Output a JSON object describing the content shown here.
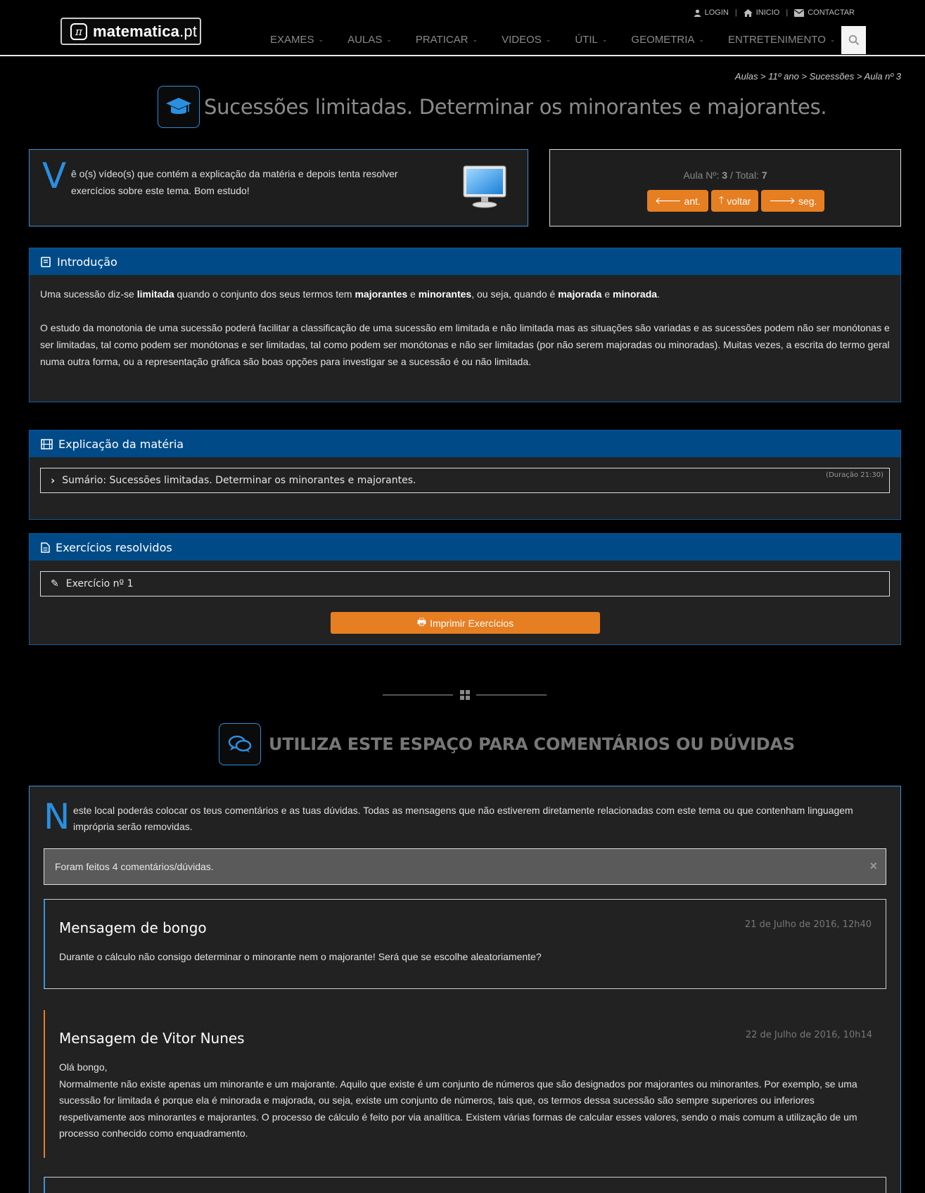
{
  "header": {
    "logo": {
      "prefix": "matematica",
      "suffix": ".pt"
    },
    "util_links": [
      {
        "label": "LOGIN",
        "icon": "user-icon"
      },
      {
        "label": "INICIO",
        "icon": "home-icon"
      },
      {
        "label": "CONTACTAR",
        "icon": "envelope-icon"
      }
    ],
    "nav": [
      "EXAMES",
      "AULAS",
      "PRATICAR",
      "VIDEOS",
      "ÚTIL",
      "GEOMETRIA",
      "ENTRETENIMENTO"
    ],
    "search_icon": "search-icon"
  },
  "breadcrumb": "Aulas > 11º ano > Sucessões > Aula nº 3",
  "page_title": "Sucessões limitadas. Determinar os minorantes e majorantes.",
  "info_box": {
    "dropcap": "V",
    "text": "ê o(s) vídeo(s) que contém a explicação da matéria e depois tenta resolver exercícios sobre este tema. Bom estudo!"
  },
  "lesson_nav": {
    "label": "Aula Nº:",
    "current": "3",
    "total_label": "/ Total:",
    "total": "7",
    "prev": "ant.",
    "back": "voltar",
    "next": "seg."
  },
  "intro_panel": {
    "title": "Introdução",
    "p1": [
      {
        "t": "Uma sucessão diz-se ",
        "b": false
      },
      {
        "t": "limitada",
        "b": true
      },
      {
        "t": " quando o conjunto dos seus termos tem ",
        "b": false
      },
      {
        "t": "majorantes",
        "b": true
      },
      {
        "t": " e ",
        "b": false
      },
      {
        "t": "minorantes",
        "b": true
      },
      {
        "t": ", ou seja, quando é ",
        "b": false
      },
      {
        "t": "majorada",
        "b": true
      },
      {
        "t": " e ",
        "b": false
      },
      {
        "t": "minorada",
        "b": true
      },
      {
        "t": ".",
        "b": false
      }
    ],
    "p2": "O estudo da monotonia de uma sucessão poderá facilitar a classificação de uma sucessão em limitada e não limitada mas as situações são variadas e as sucessões podem não ser monótonas e ser limitadas, tal como podem ser monótonas e ser limitadas, tal como podem ser monótonas e não ser limitadas (por não serem majoradas ou minoradas). Muitas vezes, a escrita do termo geral numa outra forma, ou a representação gráfica são boas opções para investigar se a sucessão é ou não limitada."
  },
  "explanation_panel": {
    "title": "Explicação da matéria",
    "item": "Sumário: Sucessões limitadas. Determinar os minorantes e majorantes.",
    "duration": "(Duração 21:30)"
  },
  "exercises_panel": {
    "title": "Exercícios resolvidos",
    "item": "Exercício nº 1",
    "print_button": "Imprimir Exercícios"
  },
  "comments": {
    "title": "UTILIZA ESTE ESPAÇO PARA COMENTÁRIOS OU DÚVIDAS",
    "dropcap": "N",
    "intro": "este local poderás colocar os teus comentários e as tuas dúvidas. Todas as mensagens que não estiverem diretamente relacionadas com este tema ou que contenham linguagem imprópria serão removidas.",
    "count_alert": "Foram feitos 4 comentários/dúvidas.",
    "close_symbol": "×",
    "messages": [
      {
        "title": "Mensagem de bongo",
        "date": "21 de Julho de 2016, 12h40",
        "body": "Durante o cálculo não consigo determinar o minorante nem o majorante! Será que se escolhe aleatoriamente?"
      },
      {
        "title": "Mensagem de Vitor Nunes",
        "date": "22 de Julho de 2016, 10h14",
        "greeting": "Olá bongo,",
        "body": "Normalmente não existe apenas um minorante e um majorante. Aquilo que existe é um conjunto de números que são designados por majorantes ou minorantes. Por exemplo, se uma sucessão for limitada é porque ela é minorada e majorada, ou seja, existe um conjunto de números, tais que, os termos dessa sucessão são sempre superiores ou inferiores respetivamente aos minorantes e majorantes. O processo de cálculo é feito por via analítica. Existem várias formas de calcular esses valores, sendo o mais comum a utilização de um processo conhecido como enquadramento."
      }
    ]
  },
  "colors": {
    "accent_blue": "#2a8fe0",
    "panel_head": "#004b87",
    "orange": "#e67e22"
  }
}
